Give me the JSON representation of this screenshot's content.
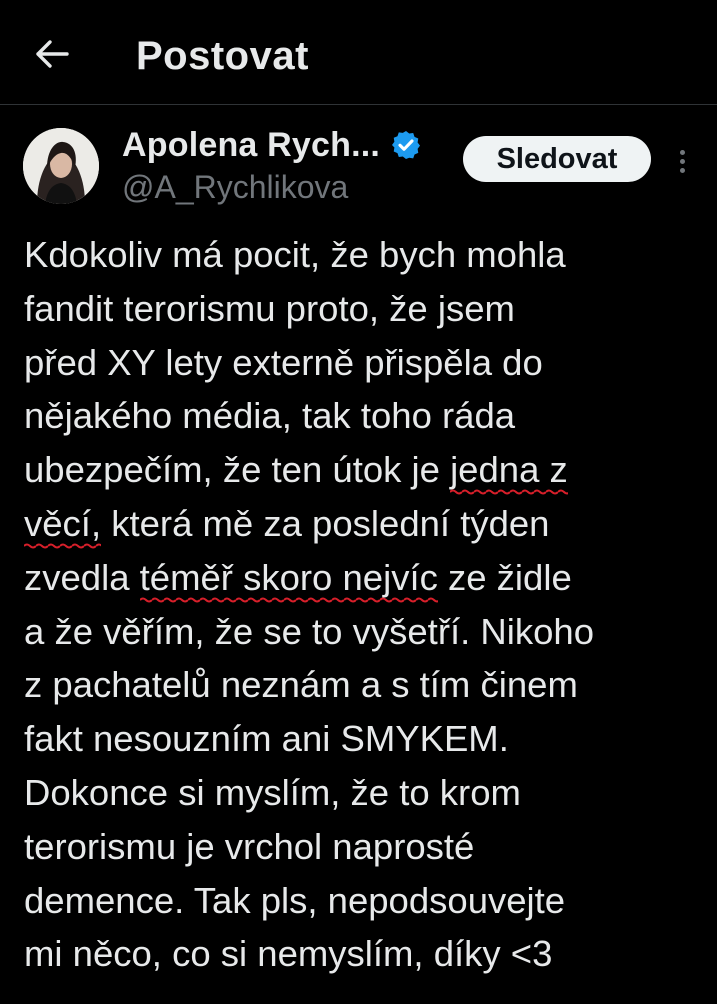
{
  "header": {
    "title": "Postovat"
  },
  "author": {
    "display_name": "Apolena Rych...",
    "handle": "@A_Rychlikova",
    "verified": true,
    "follow_label": "Sledovat"
  },
  "tweet": {
    "line_1": "Kdokoliv má pocit, že bych mohla",
    "line_2": "fandit terorismu proto, že jsem",
    "line_3": "před XY lety externě přispěla do",
    "line_4": "nějakého média, tak toho ráda",
    "line_5_a": "ubezpečím, že ten útok je ",
    "line_5_b": "jedna z",
    "line_6_a": "věcí,",
    "line_6_b": " která mě za poslední týden",
    "line_7_a": "zvedla ",
    "line_7_b": "téměř skoro nejvíc",
    "line_7_c": " ze židle",
    "line_8": "a že věřím, že se to vyšetří. Nikoho",
    "line_9": "z pachatelů neznám a s tím činem",
    "line_10": "fakt nesouzním ani SMYKEM.",
    "line_11": "Dokonce si myslím, že to krom",
    "line_12": "terorismu je vrchol naprosté",
    "line_13": "demence. Tak pls, nepodsouvejte",
    "line_14": "mi něco, co si nemyslím, díky <3"
  },
  "colors": {
    "background": "#000000",
    "text": "#e7e9ea",
    "muted": "#71767b",
    "verified_blue": "#1d9bf0",
    "spellcheck_red": "#d81f2a"
  },
  "icons": {
    "back": "arrow-left-icon",
    "verified": "verified-badge-icon",
    "more": "more-vertical-icon"
  }
}
